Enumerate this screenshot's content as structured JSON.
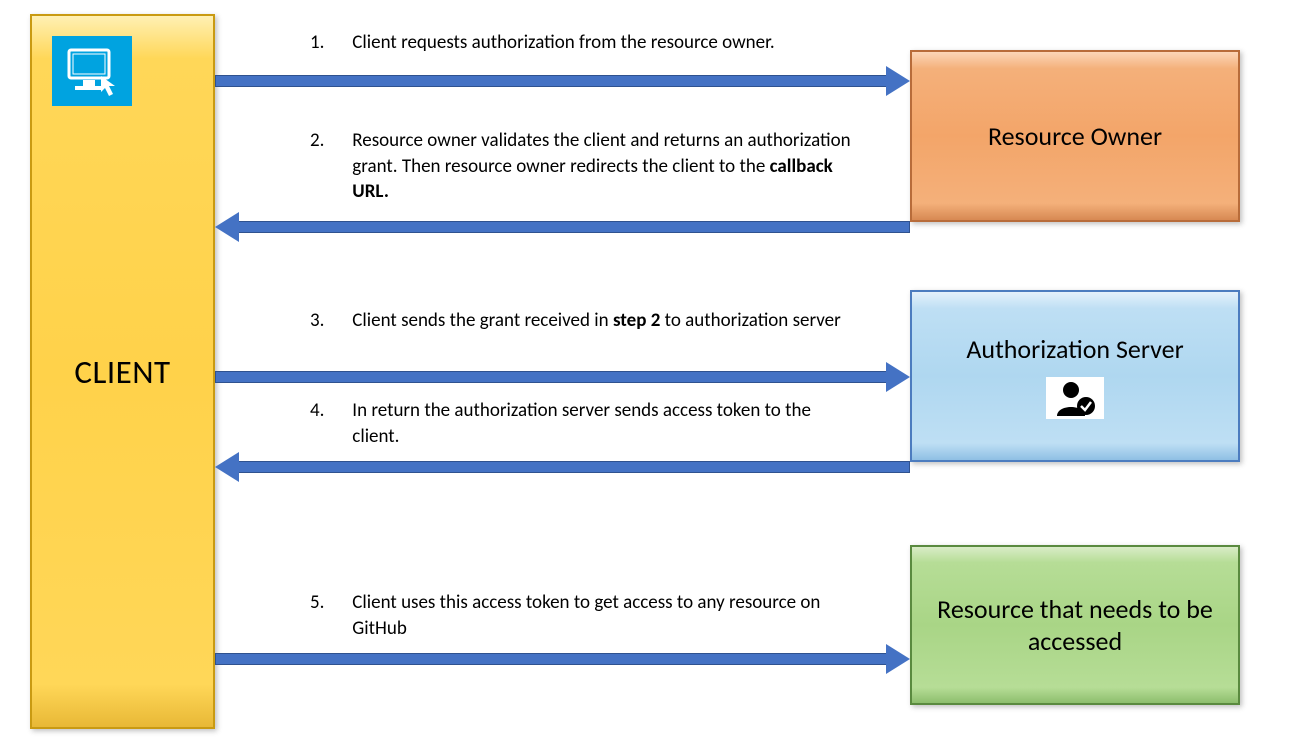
{
  "client": {
    "label": "CLIENT"
  },
  "boxes": {
    "resource_owner": "Resource Owner",
    "auth_server": "Authorization Server",
    "resource": "Resource that needs to be accessed"
  },
  "steps": {
    "s1": {
      "num": "1.",
      "text": "Client requests authorization from the resource owner."
    },
    "s2": {
      "num": "2.",
      "text_a": "Resource owner validates the client and returns an authorization grant. Then resource owner redirects the client to the ",
      "bold": "callback URL.",
      "text_b": ""
    },
    "s3": {
      "num": "3.",
      "text_a": "Client sends the grant received in ",
      "bold": "step 2",
      "text_b": " to authorization server"
    },
    "s4": {
      "num": "4.",
      "text": "In return the authorization server sends access token to the client."
    },
    "s5": {
      "num": "5.",
      "text": "Client uses this access token to get access to any resource on GitHub"
    }
  }
}
